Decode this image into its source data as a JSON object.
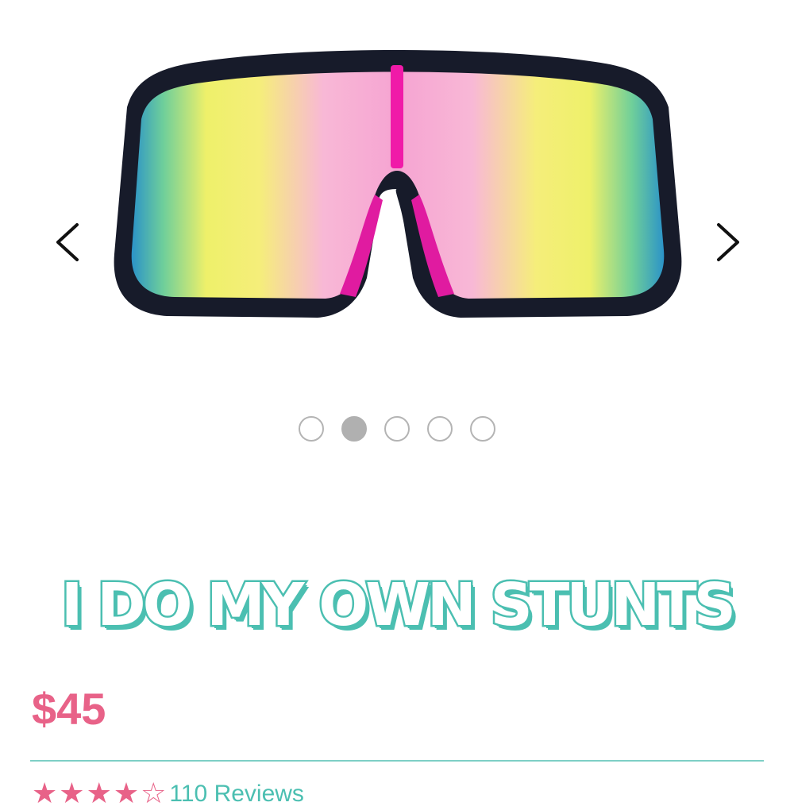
{
  "gallery": {
    "image_name": "sunglasses-product-image",
    "prev_icon": "chevron-left-icon",
    "next_icon": "chevron-right-icon",
    "slides": 5,
    "active_slide": 2
  },
  "product": {
    "title": "I DO MY OWN STUNTS",
    "price": "$45"
  },
  "rating": {
    "stars": 4.5,
    "review_count": "110 Reviews"
  },
  "colors": {
    "title_teal": "#4bbfb1",
    "price_pink": "#e86288",
    "frame_black": "#171b2a",
    "accent_magenta": "#f01aa8"
  }
}
